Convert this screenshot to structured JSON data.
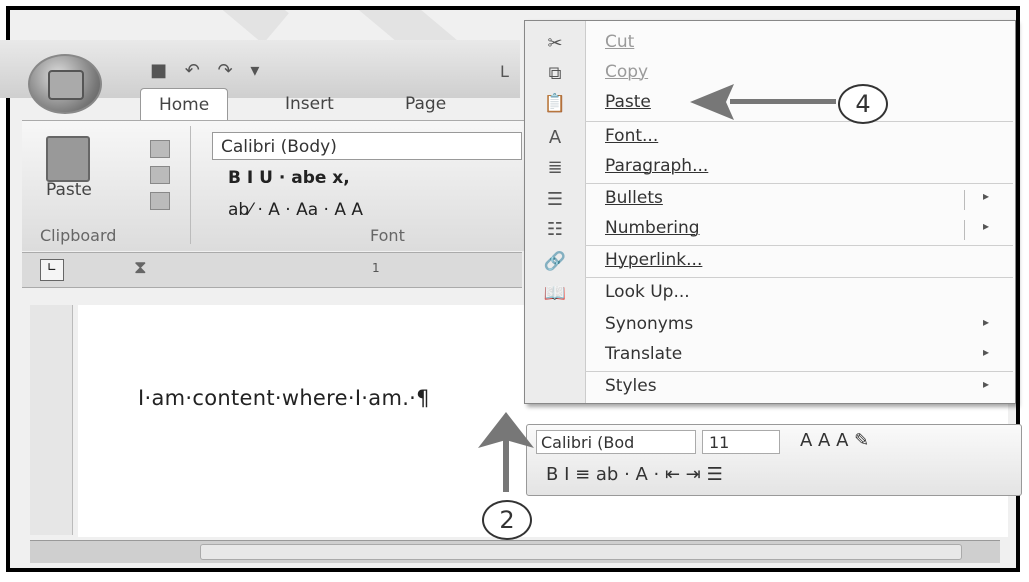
{
  "ribbon": {
    "title_fragment": "L",
    "tabs": [
      "Home",
      "Insert",
      "Page Layo"
    ],
    "clipboard": {
      "paste_label": "Paste",
      "group_label": "Clipboard"
    },
    "font": {
      "font_name": "Calibri (Body)",
      "group_label": "Font",
      "format_row": "B  I  U  ·  abe  x,",
      "color_row": "ab⁄  ·  A  ·  Aa  ·  A  A"
    }
  },
  "ruler": {
    "tick": "1"
  },
  "document": {
    "text": "I·am·content·where·I·am.·¶"
  },
  "context_menu": {
    "items": [
      {
        "label": "Cut",
        "icon": "✂",
        "disabled": true
      },
      {
        "label": "Copy",
        "icon": "⧉",
        "disabled": true
      },
      {
        "label": "Paste",
        "icon": "📋",
        "disabled": false
      },
      {
        "label": "Font...",
        "icon": "A",
        "disabled": false
      },
      {
        "label": "Paragraph...",
        "icon": "≣",
        "disabled": false
      },
      {
        "label": "Bullets",
        "icon": "☰",
        "disabled": false,
        "submenu": "▸"
      },
      {
        "label": "Numbering",
        "icon": "☷",
        "disabled": false,
        "submenu": "▸"
      },
      {
        "label": "Hyperlink...",
        "icon": "🔗",
        "disabled": false
      },
      {
        "label": "Look Up...",
        "icon": "📖",
        "disabled": false
      },
      {
        "label": "Synonyms",
        "icon": "",
        "disabled": false,
        "submenu": "▸"
      },
      {
        "label": "Translate",
        "icon": "",
        "disabled": false,
        "submenu": "▸"
      },
      {
        "label": "Styles",
        "icon": "",
        "disabled": false,
        "submenu": "▸"
      }
    ]
  },
  "mini_toolbar": {
    "font": "Calibri (Bod",
    "size": "11",
    "row1_icons": "A  A  A  ✎",
    "row2": "B  I  ≡  ab  ·  A  ·  ⇤  ⇥  ☰"
  },
  "annotations": {
    "callout_4": "4",
    "callout_2": "2"
  },
  "colors": {
    "arrow": "#777777",
    "frame": "#000000"
  }
}
